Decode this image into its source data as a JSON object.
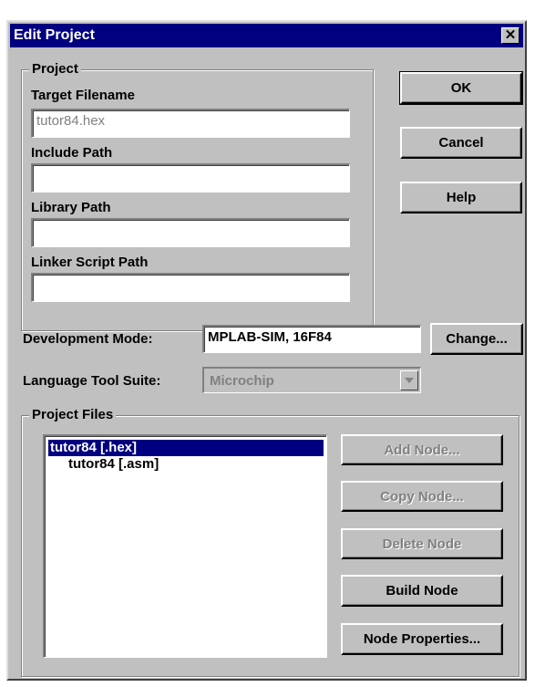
{
  "window": {
    "title": "Edit Project",
    "close_glyph": "✕"
  },
  "project_group": {
    "legend": "Project",
    "target_filename_label": "Target Filename",
    "target_filename_value": "tutor84.hex",
    "include_path_label": "Include Path",
    "include_path_value": "",
    "library_path_label": "Library Path",
    "library_path_value": "",
    "linker_script_path_label": "Linker Script Path",
    "linker_script_path_value": ""
  },
  "buttons": {
    "ok": "OK",
    "cancel": "Cancel",
    "help": "Help",
    "change": "Change..."
  },
  "development_mode": {
    "label": "Development Mode:",
    "value": "MPLAB-SIM, 16F84"
  },
  "language_tool_suite": {
    "label": "Language Tool Suite:",
    "value": "Microchip"
  },
  "project_files": {
    "legend": "Project Files",
    "items": [
      {
        "label": "tutor84 [.hex]",
        "selected": true
      },
      {
        "label": "tutor84 [.asm]",
        "selected": false
      }
    ],
    "add_node": "Add Node...",
    "copy_node": "Copy Node...",
    "delete_node": "Delete Node",
    "build_node": "Build Node",
    "node_properties": "Node Properties..."
  },
  "colors": {
    "face": "#c0c0c0",
    "titlebar": "#000080",
    "selection": "#000080",
    "disabled_text": "#808080"
  }
}
